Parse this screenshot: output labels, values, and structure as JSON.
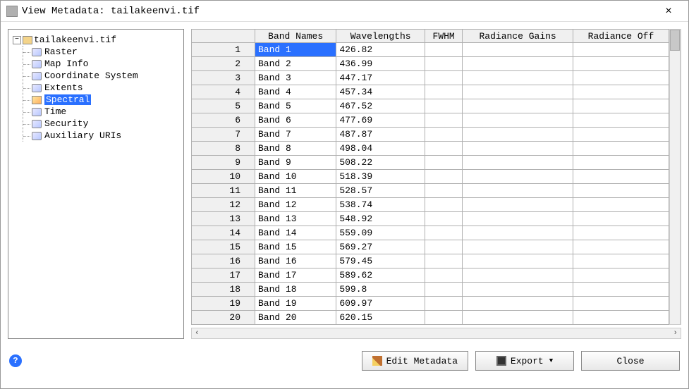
{
  "window": {
    "title": "View Metadata: tailakeenvi.tif",
    "close_glyph": "×"
  },
  "tree": {
    "root": "tailakeenvi.tif",
    "items": [
      {
        "label": "Raster"
      },
      {
        "label": "Map Info"
      },
      {
        "label": "Coordinate System"
      },
      {
        "label": "Extents"
      },
      {
        "label": "Spectral",
        "selected": true
      },
      {
        "label": "Time"
      },
      {
        "label": "Security"
      },
      {
        "label": "Auxiliary URIs"
      }
    ]
  },
  "table": {
    "columns": [
      "Band Names",
      "Wavelengths",
      "FWHM",
      "Radiance Gains",
      "Radiance Off"
    ],
    "rows": [
      {
        "n": "1",
        "name": "Band 1",
        "wl": "426.82"
      },
      {
        "n": "2",
        "name": "Band 2",
        "wl": "436.99"
      },
      {
        "n": "3",
        "name": "Band 3",
        "wl": "447.17"
      },
      {
        "n": "4",
        "name": "Band 4",
        "wl": "457.34"
      },
      {
        "n": "5",
        "name": "Band 5",
        "wl": "467.52"
      },
      {
        "n": "6",
        "name": "Band 6",
        "wl": "477.69"
      },
      {
        "n": "7",
        "name": "Band 7",
        "wl": "487.87"
      },
      {
        "n": "8",
        "name": "Band 8",
        "wl": "498.04"
      },
      {
        "n": "9",
        "name": "Band 9",
        "wl": "508.22"
      },
      {
        "n": "10",
        "name": "Band 10",
        "wl": "518.39"
      },
      {
        "n": "11",
        "name": "Band 11",
        "wl": "528.57"
      },
      {
        "n": "12",
        "name": "Band 12",
        "wl": "538.74"
      },
      {
        "n": "13",
        "name": "Band 13",
        "wl": "548.92"
      },
      {
        "n": "14",
        "name": "Band 14",
        "wl": "559.09"
      },
      {
        "n": "15",
        "name": "Band 15",
        "wl": "569.27"
      },
      {
        "n": "16",
        "name": "Band 16",
        "wl": "579.45"
      },
      {
        "n": "17",
        "name": "Band 17",
        "wl": "589.62"
      },
      {
        "n": "18",
        "name": "Band 18",
        "wl": "599.8"
      },
      {
        "n": "19",
        "name": "Band 19",
        "wl": "609.97"
      },
      {
        "n": "20",
        "name": "Band 20",
        "wl": "620.15"
      }
    ],
    "selected_row": 0
  },
  "footer": {
    "help_glyph": "?",
    "edit_label": "Edit Metadata",
    "export_label": "Export",
    "close_label": "Close"
  },
  "scroll": {
    "left_glyph": "‹",
    "right_glyph": "›"
  }
}
